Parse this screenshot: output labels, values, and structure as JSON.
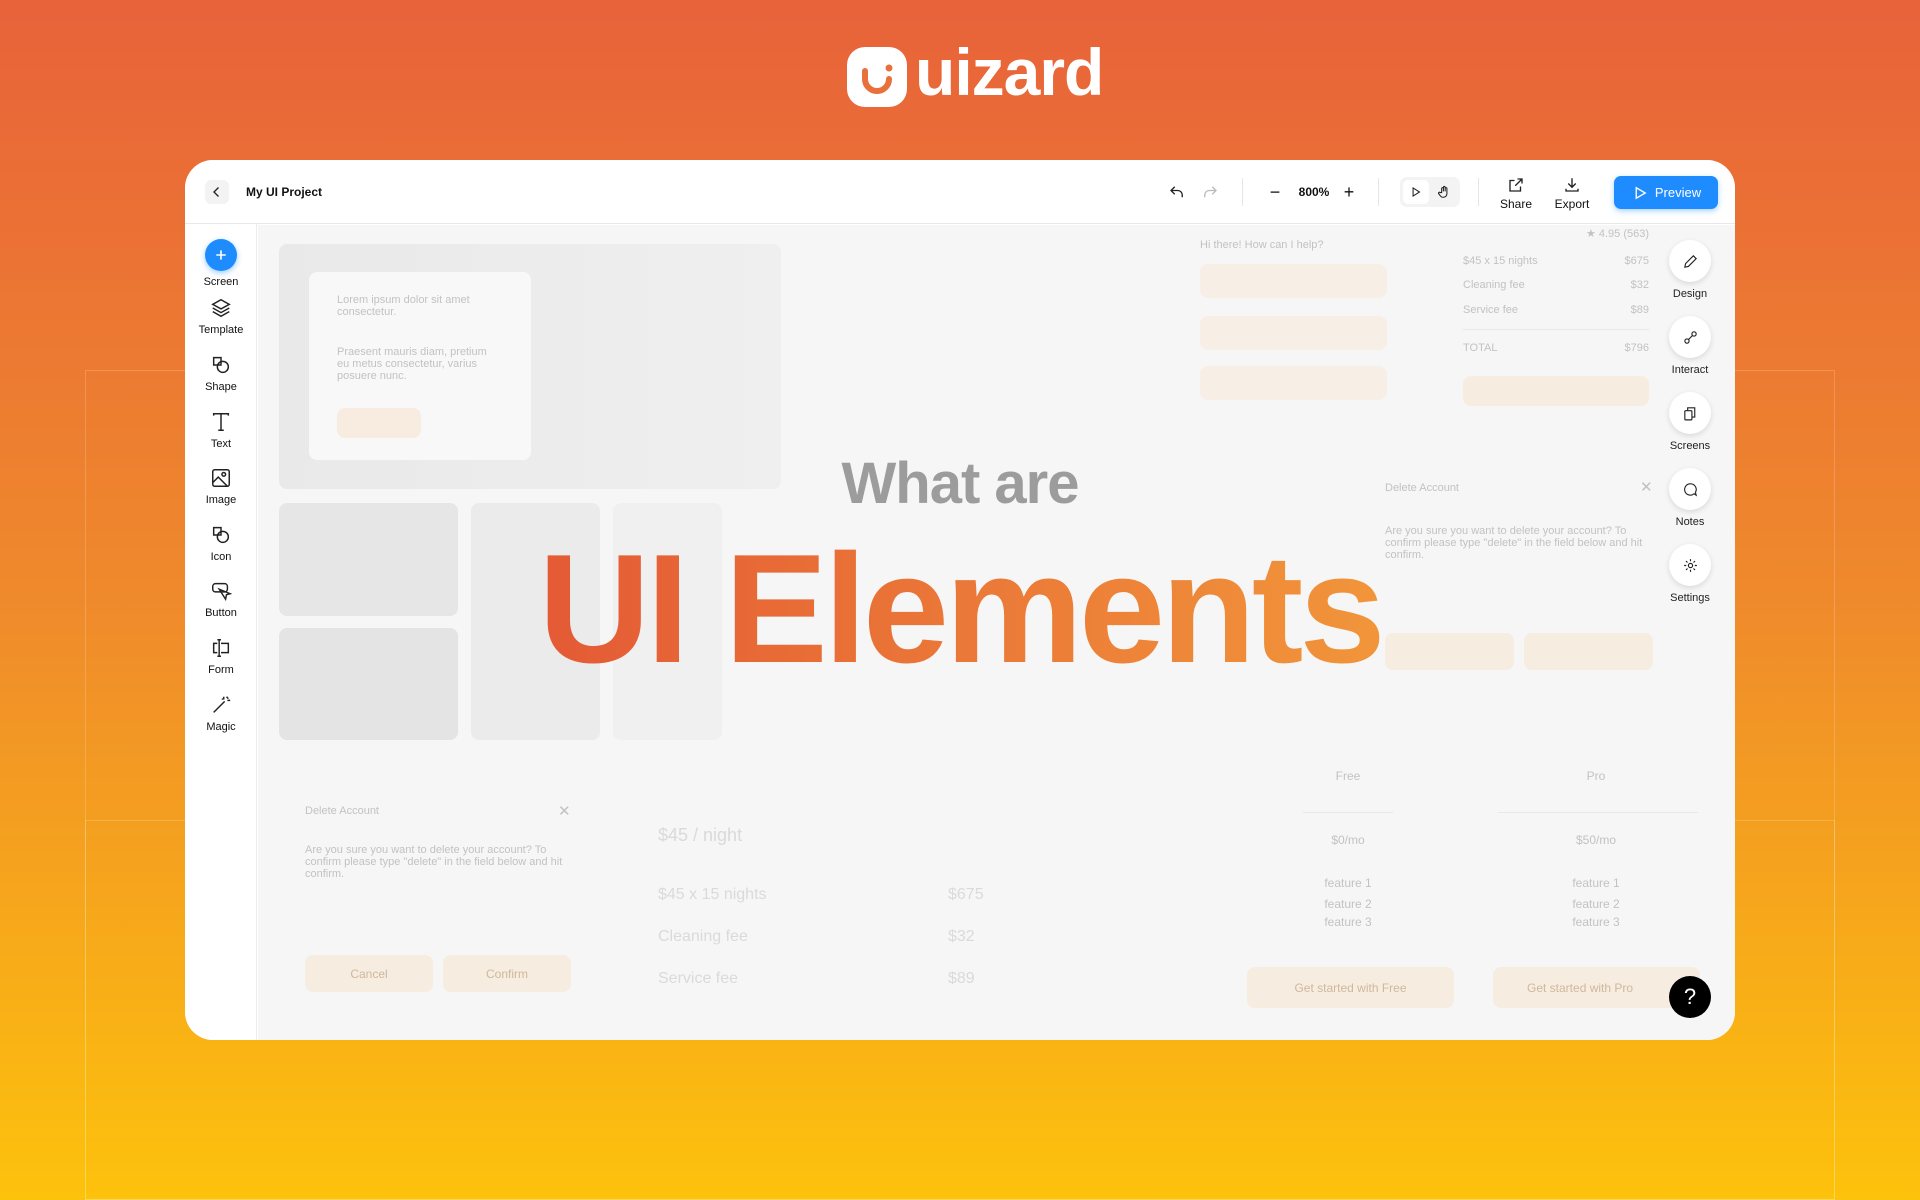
{
  "brand": {
    "name": "uizard",
    "icon": "smile-logo-icon"
  },
  "headline": {
    "line1": "What are",
    "line2": "UI Elements",
    "colors": {
      "line1": "#9c9c9c",
      "gradient_start": "#e45a35",
      "gradient_end": "#f1953a"
    }
  },
  "toolbar": {
    "back_icon": "chevron-left-icon",
    "project_title": "My UI Project",
    "zoom": "800%",
    "share": "Share",
    "export": "Export",
    "preview": "Preview",
    "preview_color": "#1e8cff"
  },
  "sidebar": {
    "items": [
      {
        "label": "Screen",
        "icon": "plus-icon"
      },
      {
        "label": "Template",
        "icon": "layers-icon"
      },
      {
        "label": "Shape",
        "icon": "shape-icon"
      },
      {
        "label": "Text",
        "icon": "text-icon"
      },
      {
        "label": "Image",
        "icon": "image-icon"
      },
      {
        "label": "Icon",
        "icon": "icon-icon"
      },
      {
        "label": "Button",
        "icon": "cursor-icon"
      },
      {
        "label": "Form",
        "icon": "form-icon"
      },
      {
        "label": "Magic",
        "icon": "magic-wand-icon"
      }
    ]
  },
  "right_panel": {
    "items": [
      {
        "label": "Design",
        "icon": "pencil-icon"
      },
      {
        "label": "Interact",
        "icon": "interact-icon"
      },
      {
        "label": "Screens",
        "icon": "screens-icon"
      },
      {
        "label": "Notes",
        "icon": "chat-icon"
      },
      {
        "label": "Settings",
        "icon": "gear-icon"
      }
    ]
  },
  "canvas": {
    "hero": {
      "title": "Lorem ipsum dolor sit amet consectetur.",
      "body": "Praesent mauris diam, pretium eu metus consectetur, varius posuere nunc."
    },
    "chat": {
      "prompt": "Hi there! How can I help?"
    },
    "booking": {
      "rating": "★ 4.95 (563)",
      "rows": [
        [
          "$45 x 15 nights",
          "$675"
        ],
        [
          "Cleaning fee",
          "$32"
        ],
        [
          "Service fee",
          "$89"
        ]
      ],
      "total": [
        "TOTAL",
        "$796"
      ]
    },
    "dialog_right": {
      "title": "Delete Account",
      "body": "Are you sure you want to delete your account? To confirm please type \"delete\" in the field below and hit confirm."
    },
    "dialog_left": {
      "title": "Delete Account",
      "body": "Are you sure you want to delete your account? To confirm please type \"delete\" in the field below and hit confirm.",
      "cancel": "Cancel",
      "confirm": "Confirm"
    },
    "price_list": {
      "header": "$45 / night",
      "rows": [
        [
          "$45 x 15 nights",
          "$675"
        ],
        [
          "Cleaning fee",
          "$32"
        ],
        [
          "Service fee",
          "$89"
        ]
      ]
    },
    "pricing": {
      "plans": [
        {
          "name": "Free",
          "price": "$0/mo",
          "features": [
            "feature 1",
            "feature 2",
            "feature 3"
          ],
          "cta": "Get started with Free"
        },
        {
          "name": "Pro",
          "price": "$50/mo",
          "features": [
            "feature 1",
            "feature 2",
            "feature 3"
          ],
          "cta": "Get started with Pro"
        }
      ]
    }
  },
  "help": {
    "label": "?"
  }
}
